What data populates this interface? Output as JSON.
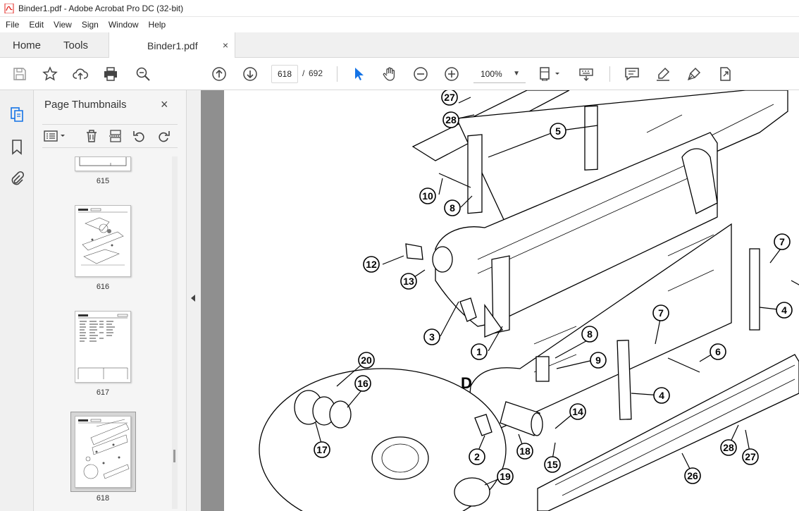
{
  "window": {
    "title": "Binder1.pdf - Adobe Acrobat Pro DC (32-bit)"
  },
  "menu": [
    "File",
    "Edit",
    "View",
    "Sign",
    "Window",
    "Help"
  ],
  "tabs": {
    "home": "Home",
    "tools": "Tools",
    "document": "Binder1.pdf",
    "close": "×"
  },
  "toolbar": {
    "current_page": "618",
    "page_separator": "/",
    "total_pages": "692",
    "zoom": "100%"
  },
  "panel": {
    "title": "Page Thumbnails",
    "close": "×",
    "thumbnails": [
      {
        "label": "615"
      },
      {
        "label": "616"
      },
      {
        "label": "617"
      },
      {
        "label": "618",
        "selected": true
      }
    ]
  },
  "drawing": {
    "section_letter": "D",
    "callouts": [
      "27",
      "28",
      "5",
      "10",
      "8",
      "12",
      "13",
      "3",
      "1",
      "7",
      "6",
      "4",
      "8",
      "9",
      "7",
      "6",
      "4",
      "20",
      "16",
      "17",
      "2",
      "18",
      "14",
      "15",
      "19",
      "28",
      "27",
      "26"
    ]
  },
  "colors": {
    "accent": "#1473e6",
    "acrobat_red": "#e0201b"
  }
}
